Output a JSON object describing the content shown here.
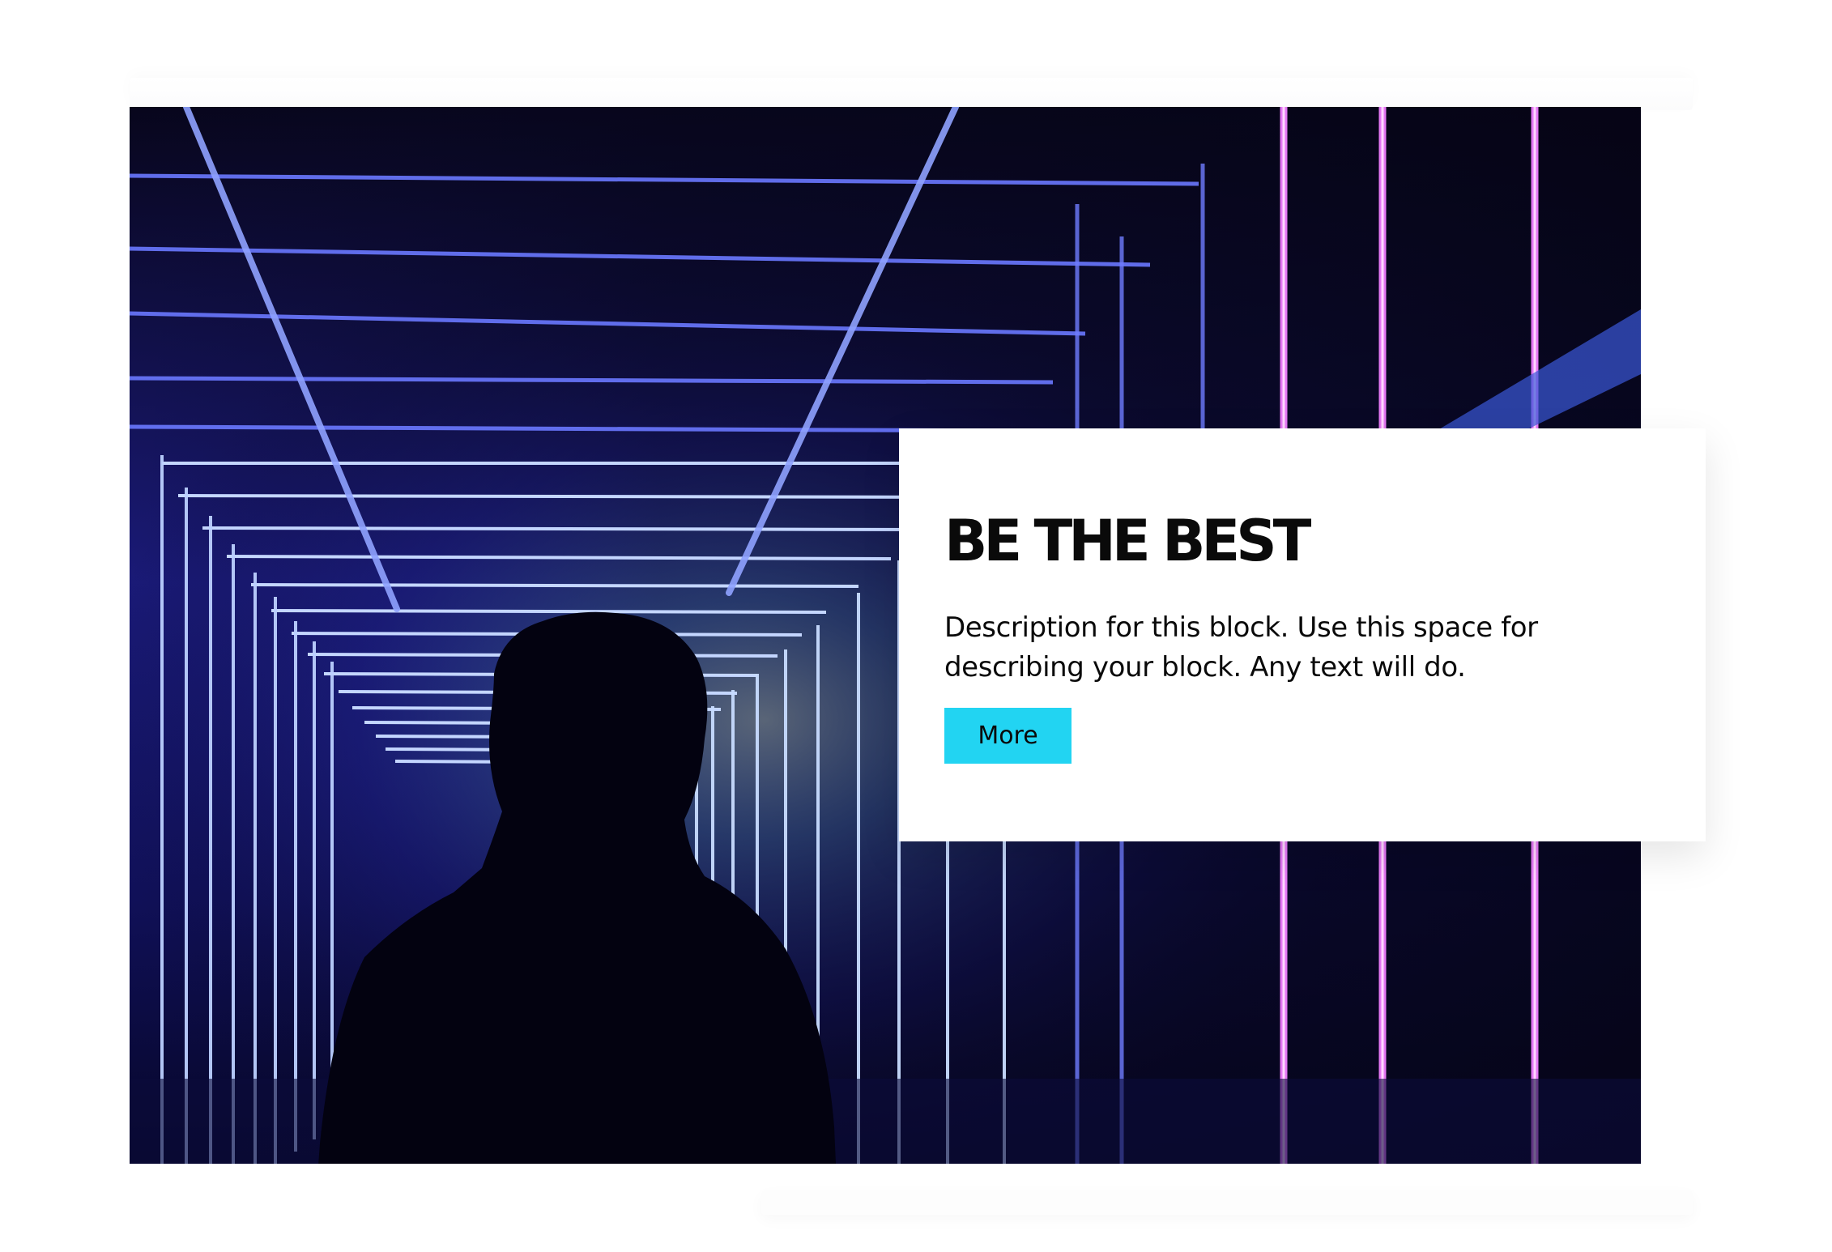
{
  "section": {
    "image": {
      "subject": "silhouetted-person-in-neon-light-tunnel"
    },
    "card": {
      "title": "BE THE BEST",
      "description": "Description for this block. Use this space for describing your block. Any text will do.",
      "button_label": "More"
    }
  },
  "colors": {
    "button_bg": "#22d4f2",
    "text": "#0a0a0a",
    "card_bg": "#ffffff",
    "neon_blue": "#4b4dff",
    "neon_magenta": "#e45cff"
  }
}
